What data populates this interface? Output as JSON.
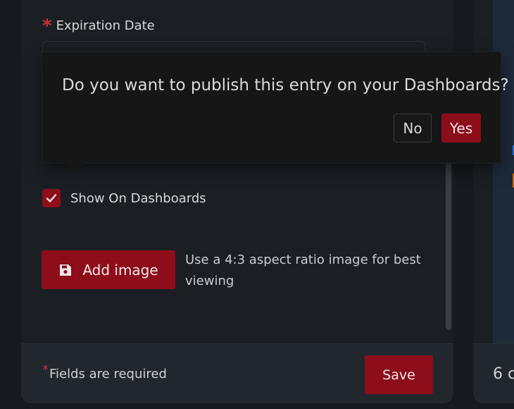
{
  "form": {
    "expiration_label": "Expiration Date",
    "show_on_dashboards_label": "Show On Dashboards",
    "show_on_dashboards_checked": true,
    "add_image_label": "Add image",
    "image_hint": "Use a 4:3 aspect ratio image for best viewing",
    "required_star": "*",
    "fields_required_label": "Fields are required",
    "save_label": "Save"
  },
  "popover": {
    "message": "Do you want to publish this entry on your Dashboards?",
    "no_label": "No",
    "yes_label": "Yes"
  },
  "right_panel": {
    "footer_text": "6 c"
  },
  "colors": {
    "accent": "#8d0d1a",
    "required": "#c8303a",
    "background": "#161a1e",
    "card": "#1b1f24"
  },
  "icons": {
    "checkbox": "check-icon",
    "add_image": "floppy-disk-icon",
    "required": "asterisk-icon"
  }
}
